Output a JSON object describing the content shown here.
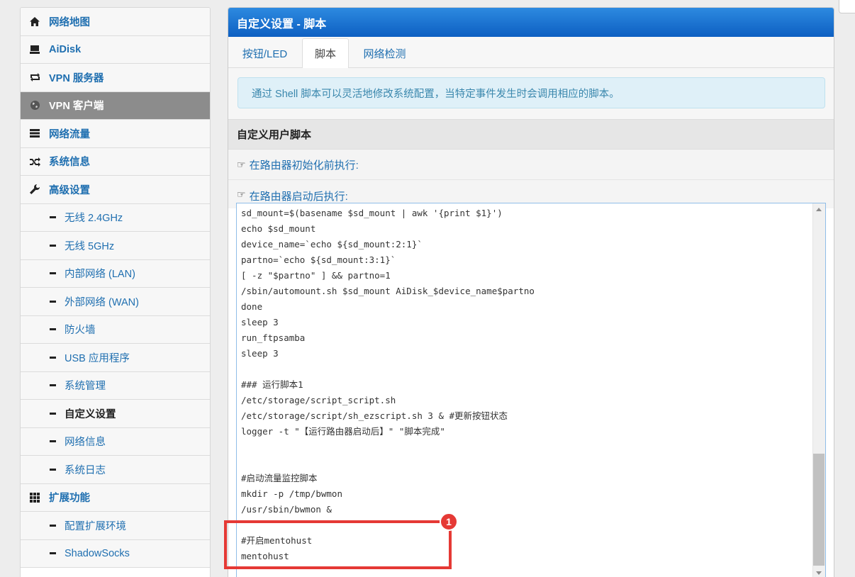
{
  "sidebar": {
    "items": [
      {
        "label": "网络地图",
        "icon": "home-icon"
      },
      {
        "label": "AiDisk",
        "icon": "disk-icon"
      },
      {
        "label": "VPN 服务器",
        "icon": "vpn-server-icon"
      },
      {
        "label": "VPN 客户端",
        "icon": "globe-icon"
      },
      {
        "label": "网络流量",
        "icon": "traffic-icon"
      },
      {
        "label": "系统信息",
        "icon": "shuffle-icon"
      },
      {
        "label": "高级设置",
        "icon": "wrench-icon"
      }
    ],
    "advanced": [
      "无线 2.4GHz",
      "无线 5GHz",
      "内部网络 (LAN)",
      "外部网络 (WAN)",
      "防火墙",
      "USB 应用程序",
      "系统管理",
      "自定义设置",
      "网络信息",
      "系统日志"
    ],
    "ext_label": "扩展功能",
    "ext_items": [
      "配置扩展环境",
      "ShadowSocks"
    ]
  },
  "panel": {
    "title": "自定义设置 - 脚本",
    "tabs": [
      "按钮/LED",
      "脚本",
      "网络检测"
    ],
    "info": "通过 Shell 脚本可以灵活地修改系统配置，当特定事件发生时会调用相应的脚本。",
    "section_title": "自定义用户脚本",
    "row_before_init": "在路由器初始化前执行:",
    "row_after_start": "在路由器启动后执行:"
  },
  "editor": {
    "code": "sd_mount=$(basename $sd_mount | awk '{print $1}')\necho $sd_mount\ndevice_name=`echo ${sd_mount:2:1}`\npartno=`echo ${sd_mount:3:1}`\n[ -z \"$partno\" ] && partno=1\n/sbin/automount.sh $sd_mount AiDisk_$device_name$partno\ndone\nsleep 3\nrun_ftpsamba\nsleep 3\n\n### 运行脚本1\n/etc/storage/script_script.sh\n/etc/storage/script/sh_ezscript.sh 3 & #更新按钮状态\nlogger -t \"【运行路由器启动后】\" \"脚本完成\"\n\n\n#启动流量监控脚本\nmkdir -p /tmp/bwmon\n/usr/sbin/bwmon &\n\n#开启mentohust\nmentohust"
  },
  "annotation": {
    "badge": "1",
    "color": "#e53935"
  }
}
